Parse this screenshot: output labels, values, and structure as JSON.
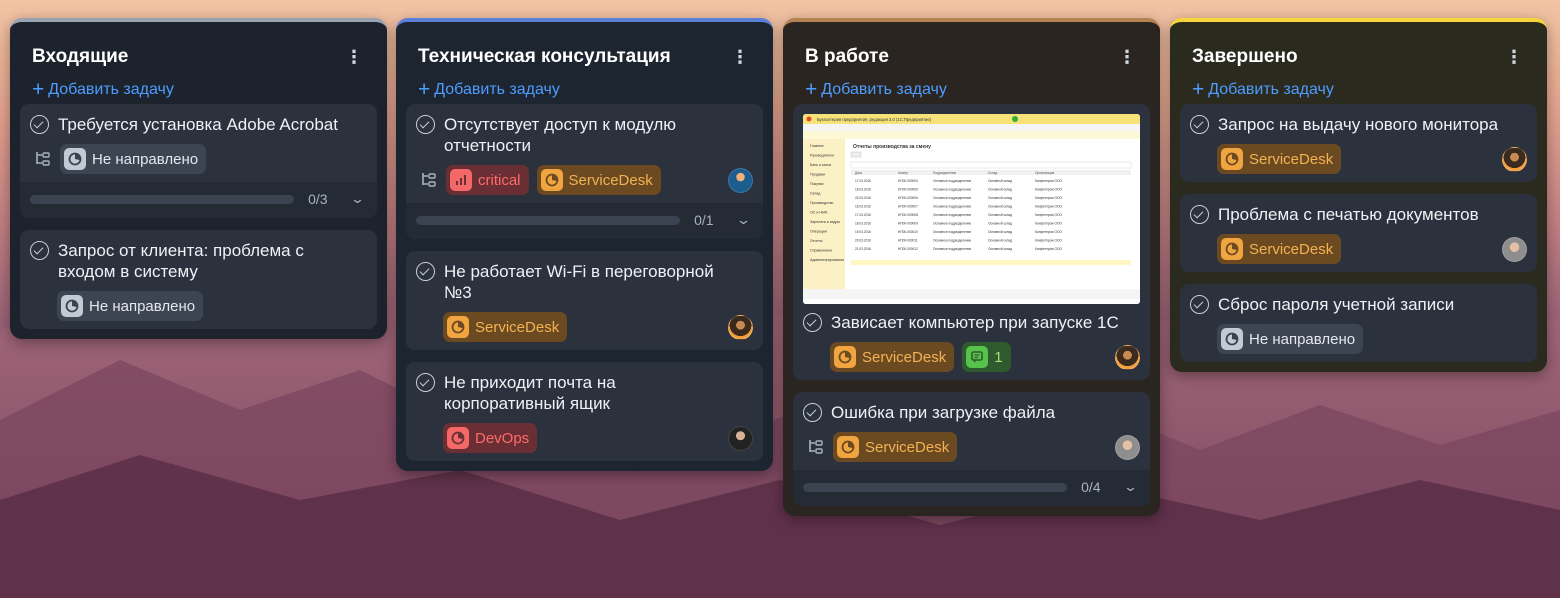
{
  "columns": [
    {
      "title": "Входящие",
      "accent": "#9aa3b1",
      "body": "#1d232c",
      "add_task": "Добавить задачу",
      "cards": [
        {
          "title": "Требуется установка Adobe Acrobat",
          "tags": [
            "Не направлено"
          ],
          "progress": "0/3",
          "progress_fraction": 0
        },
        {
          "title": "Запрос от клиента: проблема с входом в систему",
          "tags": [
            "Не направлено"
          ]
        }
      ]
    },
    {
      "title": "Техническая консультация",
      "accent": "#5b7fd9",
      "body": "#1d2530",
      "add_task": "Добавить задачу",
      "cards": [
        {
          "title": "Отсутствует доступ к модулю отчетности",
          "tags": [
            "critical",
            "ServiceDesk"
          ],
          "progress": "0/1",
          "progress_fraction": 0
        },
        {
          "title": "Не работает Wi-Fi в переговорной №3",
          "tags": [
            "ServiceDesk"
          ]
        },
        {
          "title": "Не приходит почта на корпоративный ящик",
          "tags": [
            "DevOps"
          ]
        }
      ]
    },
    {
      "title": "В работе",
      "accent": "#b38352",
      "body": "#2a2520",
      "add_task": "Добавить задачу",
      "cards": [
        {
          "title": "Зависает компьютер при запуске 1С",
          "tags": [
            "ServiceDesk"
          ],
          "comments": "1"
        },
        {
          "title": "Ошибка при загрузке файла",
          "tags": [
            "ServiceDesk"
          ],
          "progress": "0/4",
          "progress_fraction": 0
        }
      ]
    },
    {
      "title": "Завершено",
      "accent": "#f5d53a",
      "body": "#2a2a1f",
      "add_task": "Добавить задачу",
      "cards": [
        {
          "title": "Запрос на выдачу нового монитора",
          "tags": [
            "ServiceDesk"
          ]
        },
        {
          "title": "Проблема с печатью документов",
          "tags": [
            "ServiceDesk"
          ]
        },
        {
          "title": "Сброс пароля учетной записи",
          "tags": [
            "Не направлено"
          ]
        }
      ]
    }
  ],
  "screenshot_preview": {
    "window_title": "Бухгалтерия предприятия, редакция 3.0 (1С:Предприятие)",
    "form_title": "Отчеты производства за смену",
    "sidebar": [
      "Главное",
      "Руководителю",
      "Банк и касса",
      "Продажи",
      "Покупки",
      "Склад",
      "Производство",
      "ОС и НМА",
      "Зарплата и кадры",
      "Операции",
      "Отчеты",
      "Справочники",
      "Администрирование"
    ],
    "columns": [
      "Дата",
      "Номер",
      "Подразделение",
      "Склад",
      "Организация"
    ],
    "rows": [
      [
        "17.03.2016",
        "НП00-000004",
        "Основное подразделение",
        "Основной склад",
        "Конфетпром ООО"
      ],
      [
        "18.03.2016",
        "НП00-000005",
        "Основное подразделение",
        "Основной склад",
        "Конфетпром ООО"
      ],
      [
        "20.03.2016",
        "НП00-000006",
        "Основное подразделение",
        "Основной склад",
        "Конфетпром ООО"
      ],
      [
        "16.03.2016",
        "НП00-000007",
        "Основное подразделение",
        "Основной склад",
        "Конфетпром ООО"
      ],
      [
        "17.03.2016",
        "НП00-000008",
        "Основное подразделение",
        "Основной склад",
        "Конфетпром ООО"
      ],
      [
        "18.03.2016",
        "НП00-000009",
        "Основное подразделение",
        "Основной склад",
        "Конфетпром ООО"
      ],
      [
        "19.03.2016",
        "НП00-000010",
        "Основное подразделение",
        "Основной склад",
        "Конфетпром ООО"
      ],
      [
        "20.03.2016",
        "НП00-000011",
        "Основное подразделение",
        "Основной склад",
        "Конфетпром ООО"
      ],
      [
        "21.03.2016",
        "НП00-000012",
        "Основное подразделение",
        "Основной склад",
        "Конфетпром ООО"
      ]
    ]
  },
  "icons": {
    "check": "check-circle-icon",
    "add": "plus-icon",
    "menu": "kebab-menu-icon",
    "subtasks": "subtasks-icon",
    "tag": "tag-clock-icon",
    "priority": "signal-bars-icon",
    "comments": "comment-icon",
    "expand": "chevron-down-icon"
  }
}
